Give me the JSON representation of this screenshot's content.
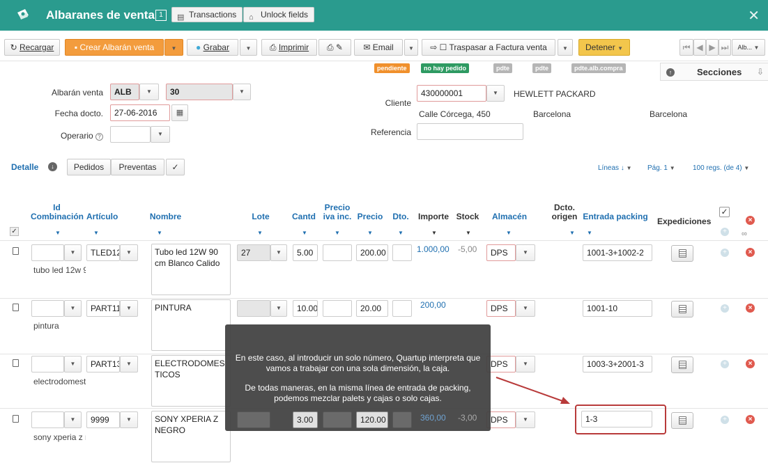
{
  "titlebar": {
    "title": "Albaranes de venta",
    "count": "1",
    "transactions_label": "Transactions",
    "unlock_label": "Unlock fields",
    "close": "✕"
  },
  "toolbar": {
    "recargar": "Recargar",
    "crear": "Crear Albarán venta",
    "grabar": "Grabar",
    "imprimir": "Imprimir",
    "email": "Email",
    "traspasar": "Traspasar a Factura venta",
    "detener": "Detener",
    "nav_label": "Alb..."
  },
  "badges": [
    {
      "label": "pendiente",
      "color": "#f0902c"
    },
    {
      "label": "no hay pedido",
      "color": "#2e9a62"
    },
    {
      "label": "pdte",
      "color": "#b5b5b5"
    },
    {
      "label": "pdte",
      "color": "#b5b5b5"
    },
    {
      "label": "pdte.alb.compra",
      "color": "#b5b5b5"
    }
  ],
  "secciones": "Secciones",
  "header": {
    "albaran_label": "Albarán venta",
    "albaran_serie": "ALB",
    "albaran_num": "30",
    "fecha_label": "Fecha docto.",
    "fecha_value": "27-06-2016",
    "operario_label": "Operario",
    "cliente_label": "Cliente",
    "cliente_code": "430000001",
    "cliente_name": "HEWLETT PACKARD",
    "cliente_address": "Calle Córcega, 450",
    "cliente_city1": "Barcelona",
    "cliente_city2": "Barcelona",
    "referencia_label": "Referencia",
    "referencia_value": ""
  },
  "detalle": {
    "title": "Detalle",
    "pedidos": "Pedidos",
    "preventas": "Preventas",
    "check": "✓",
    "lineas": "Líneas ↓",
    "pag": "Pág. 1",
    "regs": "100 regs. (de 4)"
  },
  "columns": {
    "id1": "Id",
    "id2": "Combinación",
    "articulo": "Artículo",
    "nombre": "Nombre",
    "lote": "Lote",
    "cantd": "Cantd",
    "precio_iva1": "Precio",
    "precio_iva2": "iva inc.",
    "precio": "Precio",
    "dto": "Dto.",
    "importe": "Importe",
    "stock": "Stock",
    "almacen": "Almacén",
    "dcto1": "Dcto.",
    "dcto2": "origen",
    "entrada": "Entrada packing",
    "expediciones": "Expediciones"
  },
  "rows": [
    {
      "articulo": "TLED12",
      "desc": "tubo led 12w 9",
      "nombre": "Tubo led 12W 90 cm Blanco Calido",
      "lote": "27",
      "cantd": "5.00",
      "precio": "200.00",
      "importe": "1.000,00",
      "stock": "-5,00",
      "almacen": "DPS",
      "entrada": "1001-3+1002-2"
    },
    {
      "articulo": "PART11",
      "desc": "pintura",
      "nombre": "PINTURA",
      "lote": "",
      "cantd": "10.00",
      "precio": "20.00",
      "importe": "200,00",
      "stock": "",
      "almacen": "DPS",
      "entrada": "1001-10"
    },
    {
      "articulo": "PART13",
      "desc": "electrodomest",
      "nombre": "ELECTRODOMESTICOS",
      "lote": "",
      "cantd": "",
      "precio": "",
      "importe": "",
      "stock": "",
      "almacen": "DPS",
      "entrada": "1003-3+2001-3"
    },
    {
      "articulo": "9999",
      "desc": "sony xperia z r",
      "nombre": "SONY XPERIA Z NEGRO",
      "lote": "",
      "cantd": "3.00",
      "precio": "120.00",
      "importe": "360,00",
      "stock": "-3,00",
      "almacen": "DPS",
      "entrada": "1-3"
    }
  ],
  "tooltip": {
    "line1": "En este caso, al introducir un solo número, Quartup interpreta que",
    "line2": "vamos a trabajar con una sola dimensión, la caja.",
    "line3": "De todas maneras, en la misma línea de entrada de packing,",
    "line4": "podemos mezclar palets y cajas o solo cajas."
  }
}
